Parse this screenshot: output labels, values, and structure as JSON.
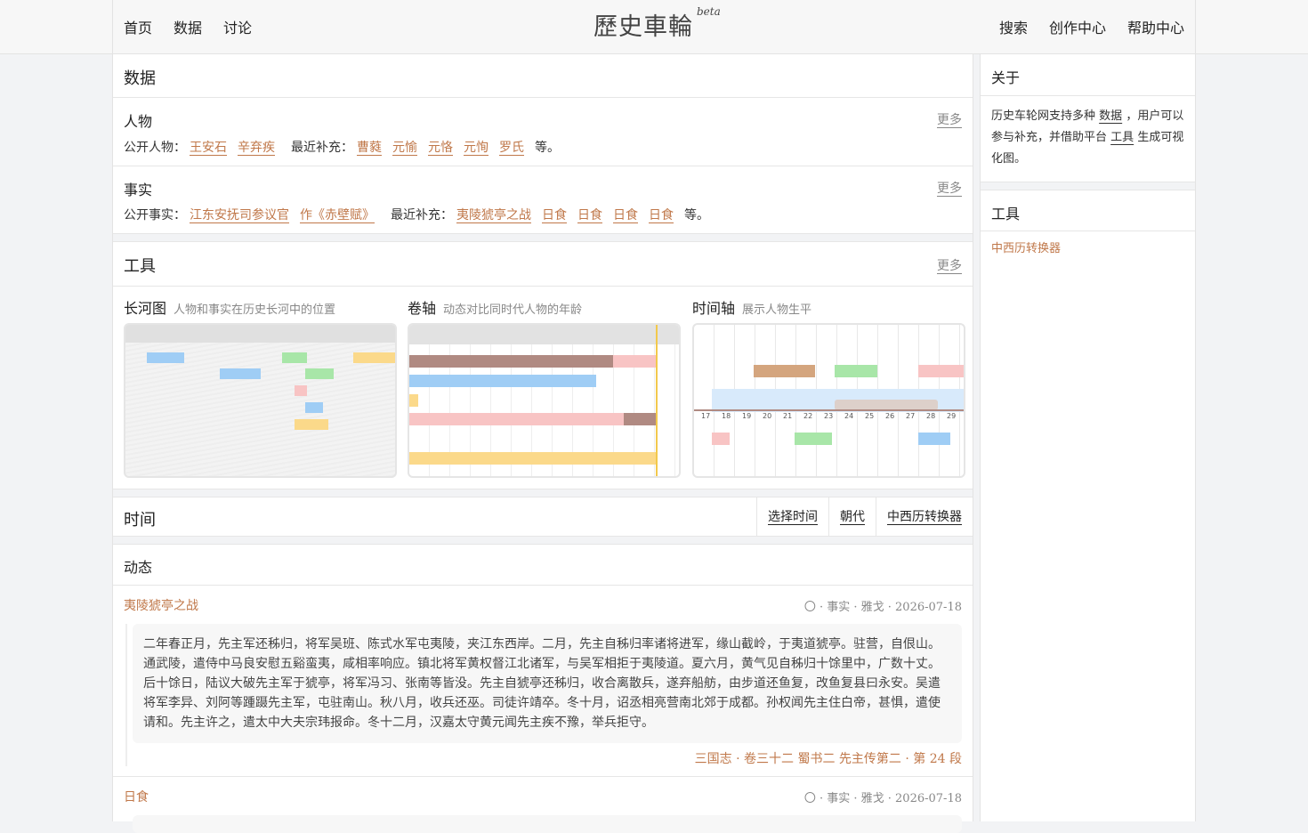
{
  "nav": {
    "left": [
      "首页",
      "数据",
      "讨论"
    ],
    "brand": "歷史車輪",
    "brand_tag": "beta",
    "right": [
      "搜索",
      "创作中心",
      "帮助中心"
    ]
  },
  "data_section": {
    "title": "数据",
    "people": {
      "title": "人物",
      "more": "更多",
      "public_label": "公开人物：",
      "public": [
        "王安石",
        "辛弃疾"
      ],
      "recent_label": "最近补充：",
      "recent": [
        "曹蕤",
        "元愉",
        "元恪",
        "元恂",
        "罗氏"
      ],
      "suffix": "等。"
    },
    "facts": {
      "title": "事实",
      "more": "更多",
      "public_label": "公开事实：",
      "public": [
        "江东安抚司参议官",
        "作《赤壁赋》"
      ],
      "recent_label": "最近补充：",
      "recent": [
        "夷陵猇亭之战",
        "日食",
        "日食",
        "日食",
        "日食"
      ],
      "suffix": "等。"
    }
  },
  "tools_section": {
    "title": "工具",
    "more": "更多",
    "items": [
      {
        "title": "长河图",
        "desc": "人物和事实在历史长河中的位置"
      },
      {
        "title": "卷轴",
        "desc": "动态对比同时代人物的年龄"
      },
      {
        "title": "时间轴",
        "desc": "展示人物生平"
      }
    ],
    "timeline_ticks": [
      "17",
      "18",
      "19",
      "20",
      "21",
      "22",
      "23",
      "24",
      "25",
      "26",
      "27",
      "28",
      "29"
    ],
    "colors": {
      "blue": "#9fcdf5",
      "green": "#a8e6a8",
      "pink": "#f8c4c4",
      "yellow": "#fbd98a",
      "brown": "#b08a82",
      "tan": "#d4a57e",
      "gold": "#f2c94c"
    }
  },
  "time_section": {
    "title": "时间",
    "tabs": [
      "选择时间",
      "朝代",
      "中西历转换器"
    ]
  },
  "feed_section": {
    "title": "动态",
    "items": [
      {
        "title": "夷陵猇亭之战",
        "meta": "〇 · 事实 · 雅戈 · 2026-07-18",
        "body": "二年春正月，先主军还秭归，将军吴班、陈式水军屯夷陵，夹江东西岸。二月，先主自秭归率诸将进军，缘山截岭，于夷道猇亭。驻营，自佷山。通武陵，遣侍中马良安慰五谿蛮夷，咸相率响应。镇北将军黄权督江北诸军，与吴军相拒于夷陵道。夏六月，黄气见自秭归十馀里中，广数十丈。后十馀日，陆议大破先主军于猇亭，将军冯习、张南等皆没。先主自猇亭还秭归，收合离散兵，遂弃船舫，由步道还鱼复，改鱼复县曰永安。吴遣将军李异、刘阿等踵蹑先主军，屯驻南山。秋八月，收兵还巫。司徒许靖卒。冬十月，诏丞相亮营南北郊于成都。孙权闻先主住白帝，甚惧，遣使请和。先主许之，遣太中大夫宗玮报命。冬十二月，汉嘉太守黄元闻先主疾不豫，举兵拒守。",
        "source": "三国志 · 卷三十二 蜀书二 先主传第二 · 第 24 段"
      },
      {
        "title": "日食",
        "meta": "〇 · 事实 · 雅戈 · 2026-07-18"
      }
    ]
  },
  "sidebar": {
    "about_title": "关于",
    "about_p1": "历史车轮网支持多种",
    "about_link1": "数据",
    "about_p2": "，用户可以参与补充，并借助平台",
    "about_link2": "工具",
    "about_p3": "生成可视化图。",
    "tools_title": "工具",
    "tools_link": "中西历转换器"
  }
}
